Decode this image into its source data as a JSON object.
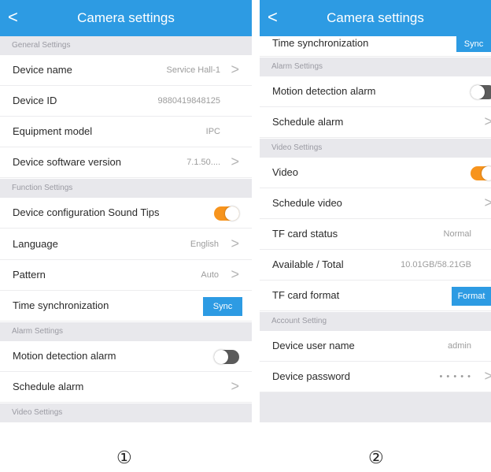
{
  "header": {
    "title": "Camera settings",
    "back_glyph": "<"
  },
  "panel1": {
    "general": {
      "section": "General Settings",
      "device_name": "Device name",
      "device_name_value": "Service Hall-1",
      "device_id": "Device ID",
      "device_id_value": "9880419848125",
      "model": "Equipment model",
      "model_value": "IPC",
      "software": "Device software version",
      "software_value": "7.1.50...."
    },
    "function": {
      "section": "Function Settings",
      "sound": "Device configuration Sound Tips",
      "sound_on": true,
      "language": "Language",
      "language_value": "English",
      "pattern": "Pattern",
      "pattern_value": "Auto",
      "time_sync": "Time synchronization",
      "sync_btn": "Sync"
    },
    "alarm": {
      "section": "Alarm Settings",
      "motion": "Motion detection alarm",
      "motion_on": false,
      "schedule": "Schedule alarm"
    },
    "video": {
      "section": "Video Settings"
    },
    "marker": "①"
  },
  "panel2": {
    "time_sync": "Time synchronization",
    "sync_btn": "Sync",
    "alarm": {
      "section": "Alarm Settings",
      "motion": "Motion detection alarm",
      "motion_on": false,
      "schedule": "Schedule alarm"
    },
    "video": {
      "section": "Video Settings",
      "video": "Video",
      "video_on": true,
      "schedule_video": "Schedule video",
      "tf_status": "TF card status",
      "tf_status_value": "Normal",
      "available": "Available / Total",
      "available_value": "10.01GB/58.21GB",
      "tf_format": "TF card format",
      "format_btn": "Format"
    },
    "account": {
      "section": "Account Setting",
      "username": "Device user name",
      "username_value": "admin",
      "password": "Device password",
      "password_value": "• • • • •"
    },
    "marker": "②"
  },
  "colors": {
    "header": "#2d9be3",
    "toggle_on": "#f7941d",
    "toggle_off": "#5b5b5b",
    "section_bg": "#e8e8ec"
  }
}
